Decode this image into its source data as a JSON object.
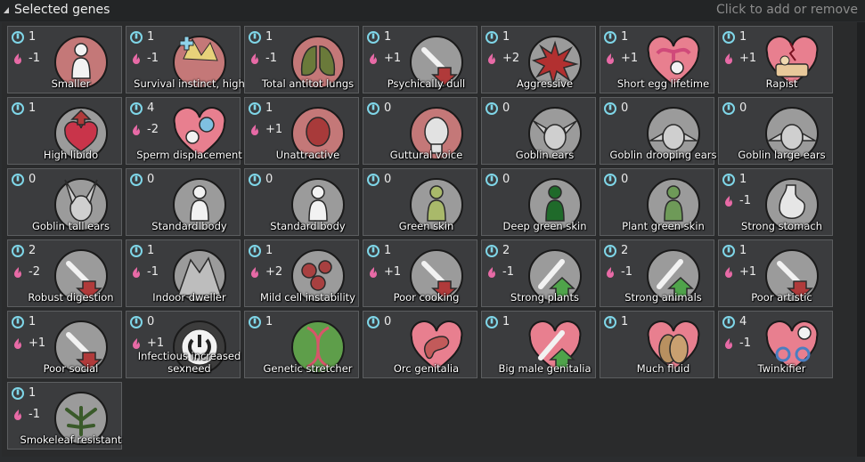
{
  "header": {
    "title": "Selected genes",
    "hint": "Click to add or remove"
  },
  "colors": {
    "complexity_icon": "#7fd6e8",
    "metabolism_icon": "#e86aa6",
    "red_circle": "#c47878",
    "grey_circle": "#9b9b9b",
    "heart": "#e87f8f",
    "green_circle": "#5e9e4a",
    "dark_circle": "#3c3c3c"
  },
  "genes": [
    {
      "label": "Smaller",
      "complexity": "1",
      "metabolism": "-1",
      "icon": "smaller-icon",
      "bg": "red_circle",
      "glyph": "body"
    },
    {
      "label": "Survival instinct, high",
      "complexity": "1",
      "metabolism": "-1",
      "icon": "survival-instinct-icon",
      "bg": "red_circle",
      "glyph": "plus"
    },
    {
      "label": "Total antitot lungs",
      "complexity": "1",
      "metabolism": "-1",
      "icon": "lungs-icon",
      "bg": "red_circle",
      "glyph": "lungs"
    },
    {
      "label": "Psychically dull",
      "complexity": "1",
      "metabolism": "+1",
      "icon": "psychically-dull-icon",
      "bg": "grey_circle",
      "glyph": "down"
    },
    {
      "label": "Aggressive",
      "complexity": "1",
      "metabolism": "+2",
      "icon": "aggressive-icon",
      "bg": "grey_circle",
      "glyph": "burst"
    },
    {
      "label": "Short egg lifetime",
      "complexity": "1",
      "metabolism": "+1",
      "icon": "egg-lifetime-icon",
      "bg": "heart",
      "glyph": "uterus"
    },
    {
      "label": "Rapist",
      "complexity": "1",
      "metabolism": "+1",
      "icon": "broken-heart-icon",
      "bg": "heart",
      "glyph": "bed"
    },
    {
      "label": "High libido",
      "complexity": "1",
      "metabolism": "",
      "icon": "high-libido-icon",
      "bg": "grey_circle",
      "glyph": "heart-up"
    },
    {
      "label": "Sperm displacement",
      "complexity": "4",
      "metabolism": "-2",
      "icon": "sperm-displacement-icon",
      "bg": "heart",
      "glyph": "sperm"
    },
    {
      "label": "Unattractive",
      "complexity": "1",
      "metabolism": "+1",
      "icon": "unattractive-icon",
      "bg": "red_circle",
      "glyph": "face"
    },
    {
      "label": "Guttural voice",
      "complexity": "0",
      "metabolism": "",
      "icon": "guttural-voice-icon",
      "bg": "red_circle",
      "glyph": "head"
    },
    {
      "label": "Goblin ears",
      "complexity": "0",
      "metabolism": "",
      "icon": "goblin-ears-icon",
      "bg": "grey_circle",
      "glyph": "ears"
    },
    {
      "label": "Goblin drooping ears",
      "complexity": "0",
      "metabolism": "",
      "icon": "goblin-drooping-ears-icon",
      "bg": "grey_circle",
      "glyph": "ears-droop"
    },
    {
      "label": "Goblin large ears",
      "complexity": "0",
      "metabolism": "",
      "icon": "goblin-large-ears-icon",
      "bg": "grey_circle",
      "glyph": "ears-droop"
    },
    {
      "label": "Goblin tall ears",
      "complexity": "0",
      "metabolism": "",
      "icon": "goblin-tall-ears-icon",
      "bg": "grey_circle",
      "glyph": "ears-tall"
    },
    {
      "label": "Standard body",
      "complexity": "0",
      "metabolism": "",
      "icon": "standard-body-icon",
      "bg": "grey_circle",
      "glyph": "body"
    },
    {
      "label": "Standard body",
      "complexity": "0",
      "metabolism": "",
      "icon": "standard-body-icon",
      "bg": "grey_circle",
      "glyph": "body"
    },
    {
      "label": "Green skin",
      "complexity": "0",
      "metabolism": "",
      "icon": "green-skin-icon",
      "bg": "grey_circle",
      "glyph": "body-green"
    },
    {
      "label": "Deep green skin",
      "complexity": "0",
      "metabolism": "",
      "icon": "deep-green-skin-icon",
      "bg": "grey_circle",
      "glyph": "body-deepgreen"
    },
    {
      "label": "Plant green skin",
      "complexity": "0",
      "metabolism": "",
      "icon": "plant-green-skin-icon",
      "bg": "grey_circle",
      "glyph": "body-plantgreen"
    },
    {
      "label": "Strong stomach",
      "complexity": "1",
      "metabolism": "-1",
      "icon": "strong-stomach-icon",
      "bg": "grey_circle",
      "glyph": "stomach"
    },
    {
      "label": "Robust digestion",
      "complexity": "2",
      "metabolism": "-2",
      "icon": "robust-digestion-icon",
      "bg": "grey_circle",
      "glyph": "stomach-red"
    },
    {
      "label": "Indoor dweller",
      "complexity": "1",
      "metabolism": "-1",
      "icon": "indoor-dweller-icon",
      "bg": "grey_circle",
      "glyph": "cave"
    },
    {
      "label": "Mild cell instability",
      "complexity": "1",
      "metabolism": "+2",
      "icon": "cell-instability-icon",
      "bg": "grey_circle",
      "glyph": "cells"
    },
    {
      "label": "Poor cooking",
      "complexity": "1",
      "metabolism": "+1",
      "icon": "poor-cooking-icon",
      "bg": "grey_circle",
      "glyph": "down"
    },
    {
      "label": "Strong plants",
      "complexity": "2",
      "metabolism": "-1",
      "icon": "strong-plants-icon",
      "bg": "grey_circle",
      "glyph": "up"
    },
    {
      "label": "Strong animals",
      "complexity": "2",
      "metabolism": "-1",
      "icon": "strong-animals-icon",
      "bg": "grey_circle",
      "glyph": "up"
    },
    {
      "label": "Poor artistic",
      "complexity": "1",
      "metabolism": "+1",
      "icon": "poor-artistic-icon",
      "bg": "grey_circle",
      "glyph": "down"
    },
    {
      "label": "Poor social",
      "complexity": "1",
      "metabolism": "+1",
      "icon": "poor-social-icon",
      "bg": "grey_circle",
      "glyph": "down"
    },
    {
      "label": "Infectious increased sexneed",
      "complexity": "0",
      "metabolism": "+1",
      "icon": "infectious-sexneed-icon",
      "bg": "dark_circle",
      "glyph": "power"
    },
    {
      "label": "Genetic stretcher",
      "complexity": "1",
      "metabolism": "",
      "icon": "genetic-stretcher-icon",
      "bg": "green_circle",
      "glyph": "dna"
    },
    {
      "label": "Orc genitalia",
      "complexity": "0",
      "metabolism": "",
      "icon": "orc-genitalia-icon",
      "bg": "heart",
      "glyph": "bean"
    },
    {
      "label": "Big male genitalia",
      "complexity": "1",
      "metabolism": "",
      "icon": "big-male-genitalia-icon",
      "bg": "heart",
      "glyph": "up"
    },
    {
      "label": "Much fluid",
      "complexity": "1",
      "metabolism": "",
      "icon": "much-fluid-icon",
      "bg": "heart",
      "glyph": "fluid"
    },
    {
      "label": "Twinkifier",
      "complexity": "4",
      "metabolism": "-1",
      "icon": "twinkifier-icon",
      "bg": "heart",
      "glyph": "gender"
    },
    {
      "label": "Smokeleaf resistant",
      "complexity": "1",
      "metabolism": "-1",
      "icon": "smokeleaf-resistant-icon",
      "bg": "grey_circle",
      "glyph": "leaf"
    }
  ]
}
